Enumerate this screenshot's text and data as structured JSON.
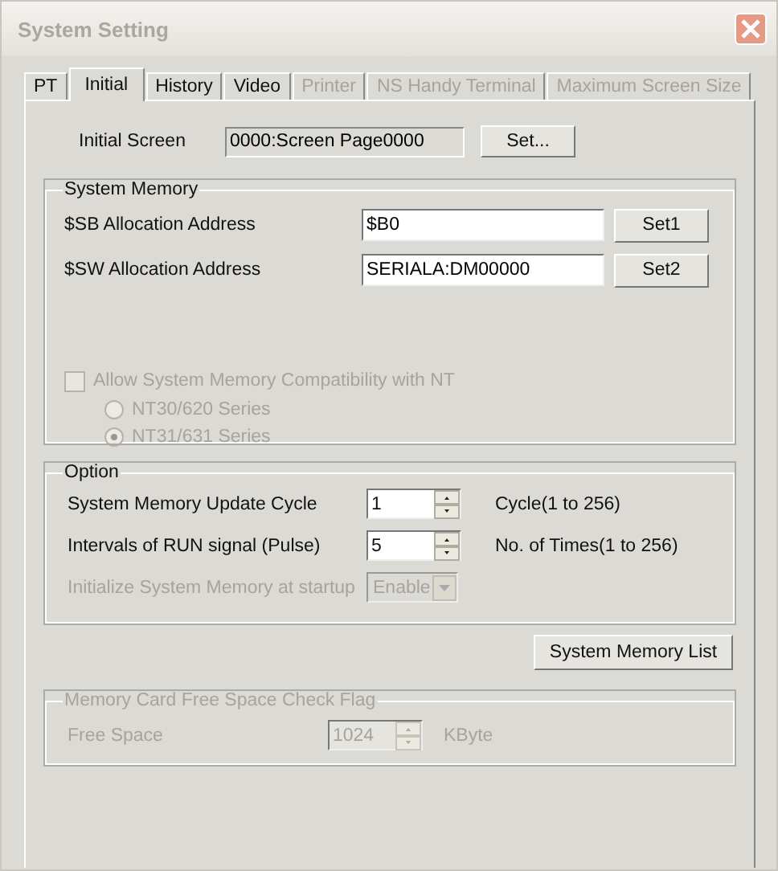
{
  "window": {
    "title": "System Setting",
    "active": false
  },
  "tabs": [
    {
      "label": "PT",
      "selected": false,
      "disabled": false
    },
    {
      "label": "Initial",
      "selected": true,
      "disabled": false
    },
    {
      "label": "History",
      "selected": false,
      "disabled": false
    },
    {
      "label": "Video",
      "selected": false,
      "disabled": false
    },
    {
      "label": "Printer",
      "selected": false,
      "disabled": true
    },
    {
      "label": "NS Handy Terminal",
      "selected": false,
      "disabled": true
    },
    {
      "label": "Maximum Screen Size",
      "selected": false,
      "disabled": true
    }
  ],
  "initial_screen": {
    "label": "Initial Screen",
    "value": "0000:Screen Page0000",
    "button": "Set..."
  },
  "system_memory": {
    "title": "System Memory",
    "rows": [
      {
        "label": "$SB Allocation Address",
        "value": "$B0",
        "button": "Set1"
      },
      {
        "label": "$SW Allocation Address",
        "value": "SERIALA:DM00000",
        "button": "Set2"
      }
    ],
    "compat": {
      "label": "Allow System Memory Compatibility with NT",
      "checked": false,
      "disabled": true
    },
    "radios": [
      {
        "label": "NT30/620 Series",
        "selected": false,
        "disabled": true
      },
      {
        "label": "NT31/631 Series",
        "selected": true,
        "disabled": true
      }
    ]
  },
  "option": {
    "title": "Option",
    "rows": [
      {
        "kind": "spin",
        "label": "System Memory Update Cycle",
        "value": "1",
        "unit": "Cycle(1 to 256)",
        "disabled": false
      },
      {
        "kind": "spin",
        "label": "Intervals of RUN signal (Pulse)",
        "value": "5",
        "unit": "No. of Times(1 to 256)",
        "disabled": false
      },
      {
        "kind": "dropdown",
        "label": "Initialize System Memory at startup",
        "value": "Enable",
        "disabled": true
      }
    ]
  },
  "list_button": "System Memory List",
  "memory_card": {
    "title": "Memory Card Free Space Check Flag",
    "disabled": true,
    "label": "Free Space",
    "value": "1024",
    "unit": "KByte"
  }
}
